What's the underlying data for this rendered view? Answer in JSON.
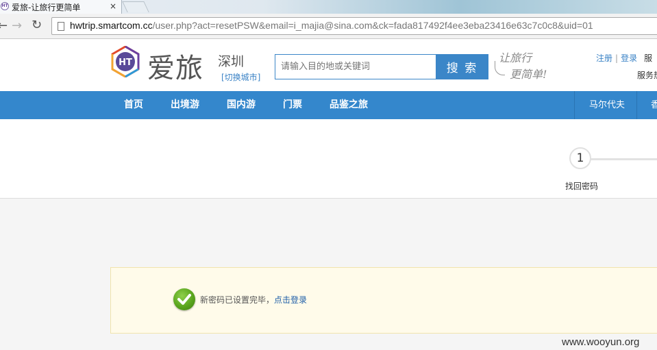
{
  "browser": {
    "tab_title": "爱旅-让旅行更简单",
    "tab_close": "×",
    "favicon_text": "HT",
    "url_host": "hwtrip.smartcom.cc",
    "url_rest": "/user.php?act=resetPSW&email=i_majia@sina.com&ck=fada817492f4ee3eba23416e63c7c0c8&uid=01"
  },
  "header": {
    "logo_text": "爱旅",
    "logo_mark_text": "HT",
    "city": "深圳",
    "city_switch": "[切换城市]",
    "search_placeholder": "请输入目的地或关键词",
    "search_button": "搜 索",
    "slogan_line1": "让旅行",
    "slogan_line2": "更简单!",
    "register": "注册",
    "separator": "|",
    "login": "登录",
    "extra": "服",
    "service": "服务热"
  },
  "nav": {
    "items": [
      "首页",
      "出境游",
      "国内游",
      "门票",
      "品鉴之旅"
    ],
    "side_item": "马尔代夫",
    "side_item2": "香"
  },
  "steps": {
    "current_number": "1",
    "current_label": "找回密码"
  },
  "message": {
    "text": "新密码已设置完毕，",
    "link": "点击登录"
  },
  "watermark": "www.wooyun.org",
  "colors": {
    "brand_blue": "#3487cc",
    "success_green": "#5aa51d",
    "notice_bg": "#fffbea"
  }
}
